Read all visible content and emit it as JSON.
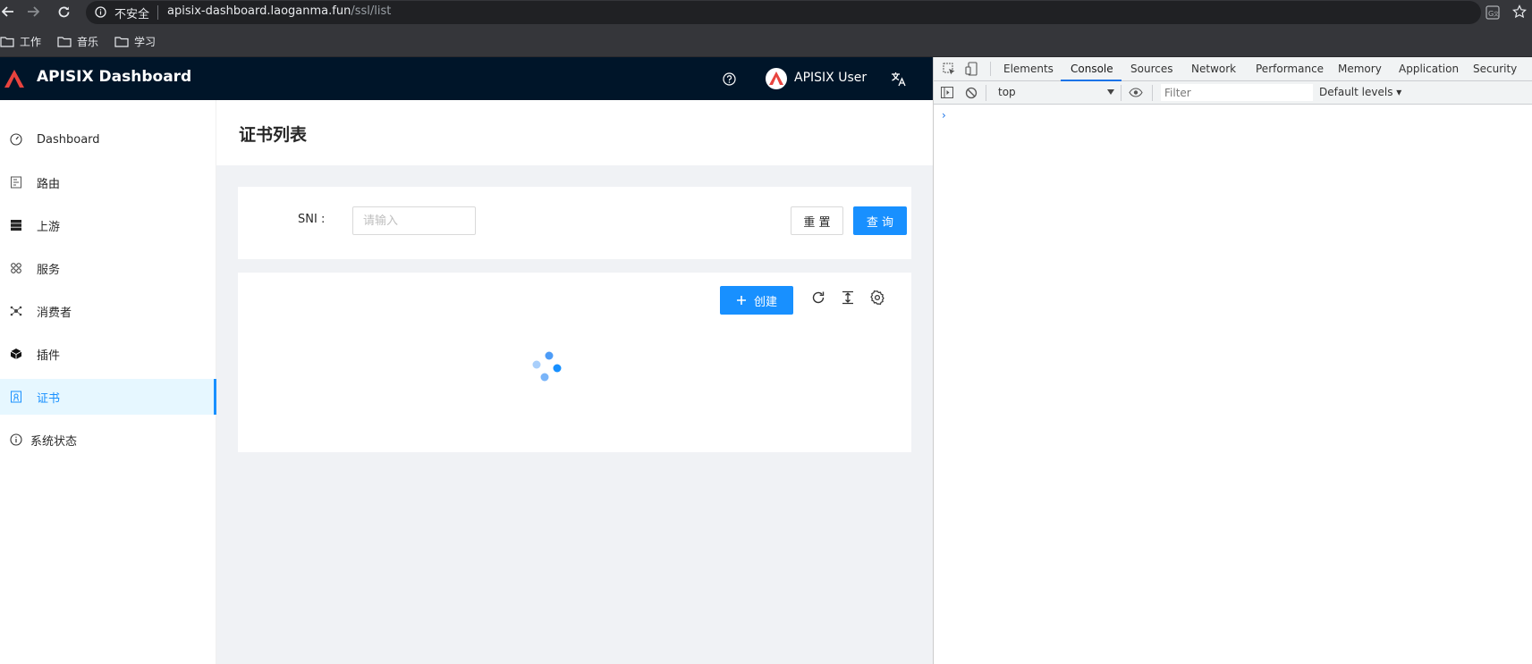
{
  "browser": {
    "security_label": "不安全",
    "url_host": "apisix-dashboard.laoganma.fun",
    "url_path": "/ssl/list",
    "bookmarks": [
      {
        "label": "工作"
      },
      {
        "label": "音乐"
      },
      {
        "label": "学习"
      }
    ]
  },
  "app": {
    "title": "APISIX Dashboard",
    "user_name": "APISIX User",
    "brand_color": "#e8433e",
    "accent_color": "#1890ff"
  },
  "sidebar": {
    "items": [
      {
        "label": "Dashboard",
        "icon": "dashboard-icon"
      },
      {
        "label": "路由",
        "icon": "route-icon"
      },
      {
        "label": "上游",
        "icon": "upstream-icon"
      },
      {
        "label": "服务",
        "icon": "service-icon"
      },
      {
        "label": "消费者",
        "icon": "consumer-icon"
      },
      {
        "label": "插件",
        "icon": "plugin-icon"
      },
      {
        "label": "证书",
        "icon": "certificate-icon",
        "active": true
      },
      {
        "label": "系统状态",
        "icon": "info-icon"
      }
    ]
  },
  "page": {
    "title": "证书列表",
    "search": {
      "sni_label": "SNI",
      "sni_placeholder": "请输入",
      "sni_value": "",
      "reset_label": "重 置",
      "query_label": "查 询"
    },
    "table": {
      "create_label": "创建",
      "loading": true
    }
  },
  "devtools": {
    "tabs": [
      "Elements",
      "Console",
      "Sources",
      "Network",
      "Performance",
      "Memory",
      "Application",
      "Security"
    ],
    "active_tab": "Console",
    "context": "top",
    "filter_placeholder": "Filter",
    "levels_label": "Default levels"
  }
}
